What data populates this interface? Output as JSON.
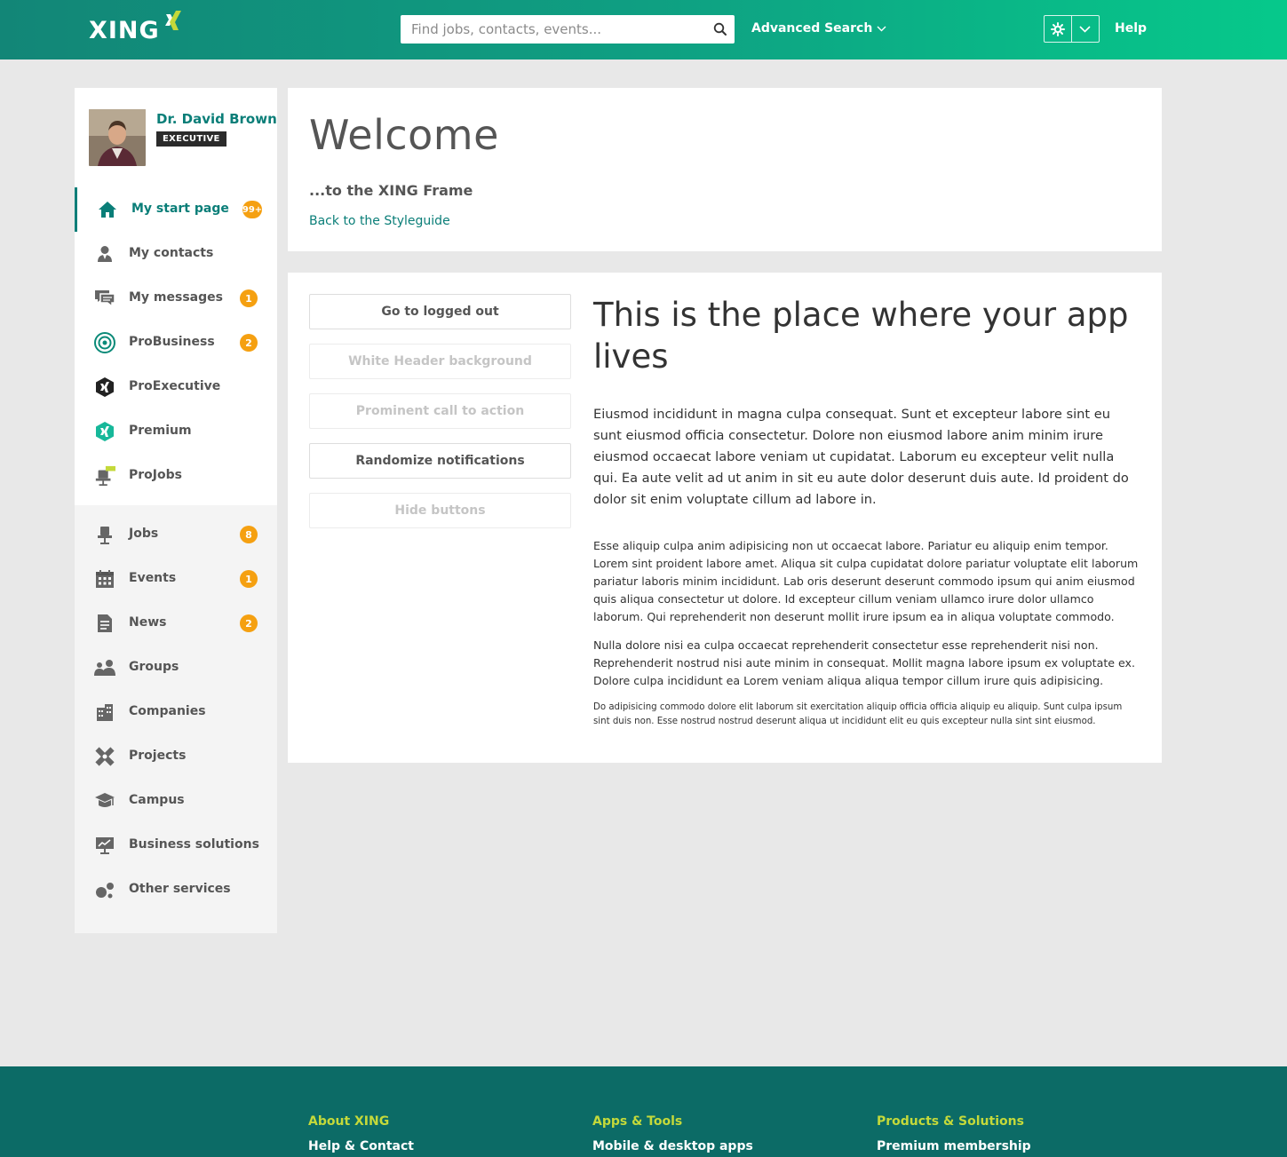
{
  "header": {
    "logo_text": "XING",
    "search_placeholder": "Find jobs, contacts, events...",
    "advanced_search": "Advanced Search",
    "help": "Help",
    "brand_color": "#0a7e78"
  },
  "profile": {
    "name": "Dr. David Brown",
    "badge": "EXECUTIVE"
  },
  "sidebar": {
    "primary": [
      {
        "label": "My start page",
        "count": "99+",
        "icon": "home-icon"
      },
      {
        "label": "My contacts",
        "count": "",
        "icon": "contacts-icon"
      },
      {
        "label": "My messages",
        "count": "1",
        "icon": "messages-icon"
      },
      {
        "label": "ProBusiness",
        "count": "2",
        "icon": "probusiness-icon"
      },
      {
        "label": "ProExecutive",
        "count": "",
        "icon": "proexecutive-icon"
      },
      {
        "label": "Premium",
        "count": "",
        "icon": "premium-icon"
      },
      {
        "label": "ProJobs",
        "count": "",
        "icon": "projobs-icon"
      }
    ],
    "secondary": [
      {
        "label": "Jobs",
        "count": "8",
        "icon": "jobs-icon"
      },
      {
        "label": "Events",
        "count": "1",
        "icon": "events-icon"
      },
      {
        "label": "News",
        "count": "2",
        "icon": "news-icon"
      },
      {
        "label": "Groups",
        "count": "",
        "icon": "groups-icon"
      },
      {
        "label": "Companies",
        "count": "",
        "icon": "companies-icon"
      },
      {
        "label": "Projects",
        "count": "",
        "icon": "projects-icon"
      },
      {
        "label": "Campus",
        "count": "",
        "icon": "campus-icon"
      },
      {
        "label": "Business solutions",
        "count": "",
        "icon": "business-solutions-icon"
      },
      {
        "label": "Other services",
        "count": "",
        "icon": "other-services-icon"
      }
    ],
    "badge_color": "#f5a011"
  },
  "welcome": {
    "title": "Welcome",
    "subtitle": "...to the XING Frame",
    "link": "Back to the Styleguide"
  },
  "buttons": [
    {
      "label": "Go to logged out",
      "enabled": true
    },
    {
      "label": "White Header background",
      "enabled": false
    },
    {
      "label": "Prominent call to action",
      "enabled": false
    },
    {
      "label": "Randomize notifications",
      "enabled": true
    },
    {
      "label": "Hide buttons",
      "enabled": false
    }
  ],
  "content": {
    "heading": "This is the place where your app lives",
    "p1": "Eiusmod incididunt in magna culpa consequat. Sunt et excepteur labore sint eu sunt eiusmod officia consectetur. Dolore non eiusmod labore anim minim irure eiusmod occaecat labore veniam ut cupidatat. Laborum eu excepteur velit nulla qui. Ea aute velit ad ut anim in sit eu aute dolor deserunt duis aute. Id proident do dolor sit enim voluptate cillum ad labore in.",
    "p2": "Esse aliquip culpa anim adipisicing non ut occaecat labore. Pariatur eu aliquip enim tempor. Lorem sint proident labore amet. Aliqua sit culpa cupidatat dolore pariatur voluptate elit laborum pariatur laboris minim incididunt. Lab oris deserunt deserunt commodo ipsum qui anim eiusmod quis aliqua consectetur ut dolore. Id excepteur cillum veniam ullamco irure dolor ullamco laborum. Qui reprehenderit non deserunt mollit irure ipsum ea in aliqua voluptate commodo.",
    "p3": "Nulla dolore nisi ea culpa occaecat reprehenderit consectetur esse reprehenderit nisi non. Reprehenderit nostrud nisi aute minim in consequat. Mollit magna labore ipsum ex voluptate ex. Dolore culpa incididunt ea Lorem veniam aliqua aliqua tempor cillum irure quis adipisicing.",
    "p4": "Do adipisicing commodo dolore elit laborum sit exercitation aliquip officia officia aliquip eu aliquip. Sunt culpa ipsum sint duis non. Esse nostrud nostrud deserunt aliqua ut incididunt elit eu quis excepteur nulla sint sint eiusmod."
  },
  "footer": {
    "columns": [
      {
        "heading": "About XING",
        "item": "Help & Contact"
      },
      {
        "heading": "Apps & Tools",
        "item": "Mobile & desktop apps"
      },
      {
        "heading": "Products & Solutions",
        "item": "Premium membership"
      }
    ],
    "heading_color": "#c4d93a"
  }
}
